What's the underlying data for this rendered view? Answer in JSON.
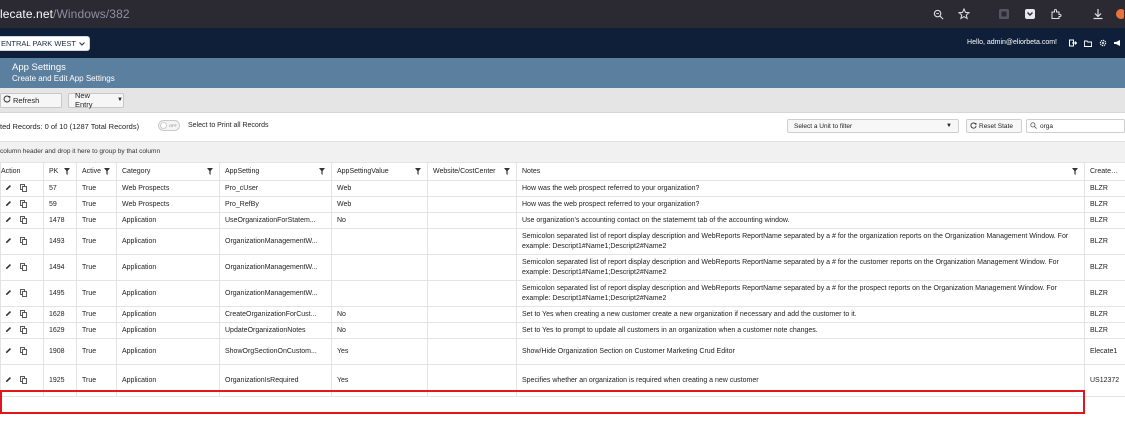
{
  "browser": {
    "url_host": "lecate.net",
    "url_path": "/Windows/382",
    "icons": [
      "zoom-icon",
      "bookmark-star-icon",
      "extension-icon",
      "pocket-icon",
      "extensions-puzzle-icon",
      "download-icon",
      "profile-icon"
    ]
  },
  "nav": {
    "unit_select": "ENTRAL PARK WEST",
    "hello_text": "Hello, admin@eliorbeta.com!",
    "icons": [
      "logout-icon",
      "folder-icon",
      "gear-icon",
      "megaphone-icon"
    ]
  },
  "page": {
    "title": "App Settings",
    "subtitle": "Create and Edit App Settings"
  },
  "toolbar": {
    "refresh_label": "Refresh",
    "new_entry_label": "New Entry"
  },
  "records": {
    "summary": "ted Records: 0 of 10 (1287 Total Records)",
    "toggle_label": "OFF",
    "print_label": "Select to Print all Records",
    "unit_filter_placeholder": "Select a Unit to filter",
    "reset_state_label": "Reset State",
    "search_value": "orga"
  },
  "group_bar_text": "column header and drop it here to group by that column",
  "table": {
    "columns": [
      "Action",
      "PK",
      "Active",
      "Category",
      "AppSetting",
      "AppSettingValue",
      "Website/CostCenter",
      "Notes",
      "Created B"
    ],
    "rows": [
      {
        "pk": "57",
        "active": "True",
        "category": "Web Prospects",
        "setting": "Pro_cUser",
        "value": "Web",
        "website": "",
        "notes": "How was the web prospect referred to your organization?",
        "created": "BLZR"
      },
      {
        "pk": "59",
        "active": "True",
        "category": "Web Prospects",
        "setting": "Pro_RefBy",
        "value": "Web",
        "website": "",
        "notes": "How was the web prospect referred to your organization?",
        "created": "BLZR"
      },
      {
        "pk": "1478",
        "active": "True",
        "category": "Application",
        "setting": "UseOrganizationForStatem...",
        "value": "No",
        "website": "",
        "notes": "Use organization's accounting contact on the statememt tab of the accounting window.",
        "created": "BLZR"
      },
      {
        "pk": "1493",
        "active": "True",
        "category": "Application",
        "setting": "OrganizationManagementW...",
        "value": "",
        "website": "",
        "notes": "Semicolon separated list of report display description and WebReports ReportName separated by a # for the organization reports on the Organization Management Window. For example: Descript1#Name1;Descript2#Name2",
        "created": "BLZR"
      },
      {
        "pk": "1494",
        "active": "True",
        "category": "Application",
        "setting": "OrganizationManagementW...",
        "value": "",
        "website": "",
        "notes": "Semicolon separated list of report display description and WebReports ReportName separated by a # for the customer reports on the Organization Management Window. For example: Descript1#Name1;Descript2#Name2",
        "created": "BLZR"
      },
      {
        "pk": "1495",
        "active": "True",
        "category": "Application",
        "setting": "OrganizationManagementW...",
        "value": "",
        "website": "",
        "notes": "Semicolon separated list of report display description and WebReports ReportName separated by a # for the prospect reports on the Organization Management Window. For example: Descript1#Name1;Descript2#Name2",
        "created": "BLZR"
      },
      {
        "pk": "1628",
        "active": "True",
        "category": "Application",
        "setting": "CreateOrganizationForCust...",
        "value": "No",
        "website": "",
        "notes": "Set to Yes when creating a new customer create a new organization if necessary and add the customer to it.",
        "created": "BLZR"
      },
      {
        "pk": "1629",
        "active": "True",
        "category": "Application",
        "setting": "UpdateOrganizationNotes",
        "value": "No",
        "website": "",
        "notes": "Set to Yes to prompt to update all customers in an organization when a customer note changes.",
        "created": "BLZR"
      },
      {
        "pk": "1908",
        "active": "True",
        "category": "Application",
        "setting": "ShowOrgSectionOnCustom...",
        "value": "Yes",
        "website": "",
        "notes": "Show/Hide Organization Section on Customer Marketing Crud Editor",
        "created": "Elecate1"
      },
      {
        "pk": "1925",
        "active": "True",
        "category": "Application",
        "setting": "OrganizationIsRequired",
        "value": "Yes",
        "website": "",
        "notes": "Specifies whether an organization is required when creating a new customer",
        "created": "US12372"
      }
    ]
  },
  "colors": {
    "browser_bar": "#2b2a33",
    "app_nav": "#0f1f3a",
    "page_header": "#5b7f9e",
    "toolbar": "#e5e5e5",
    "highlight": "#e0161b"
  }
}
